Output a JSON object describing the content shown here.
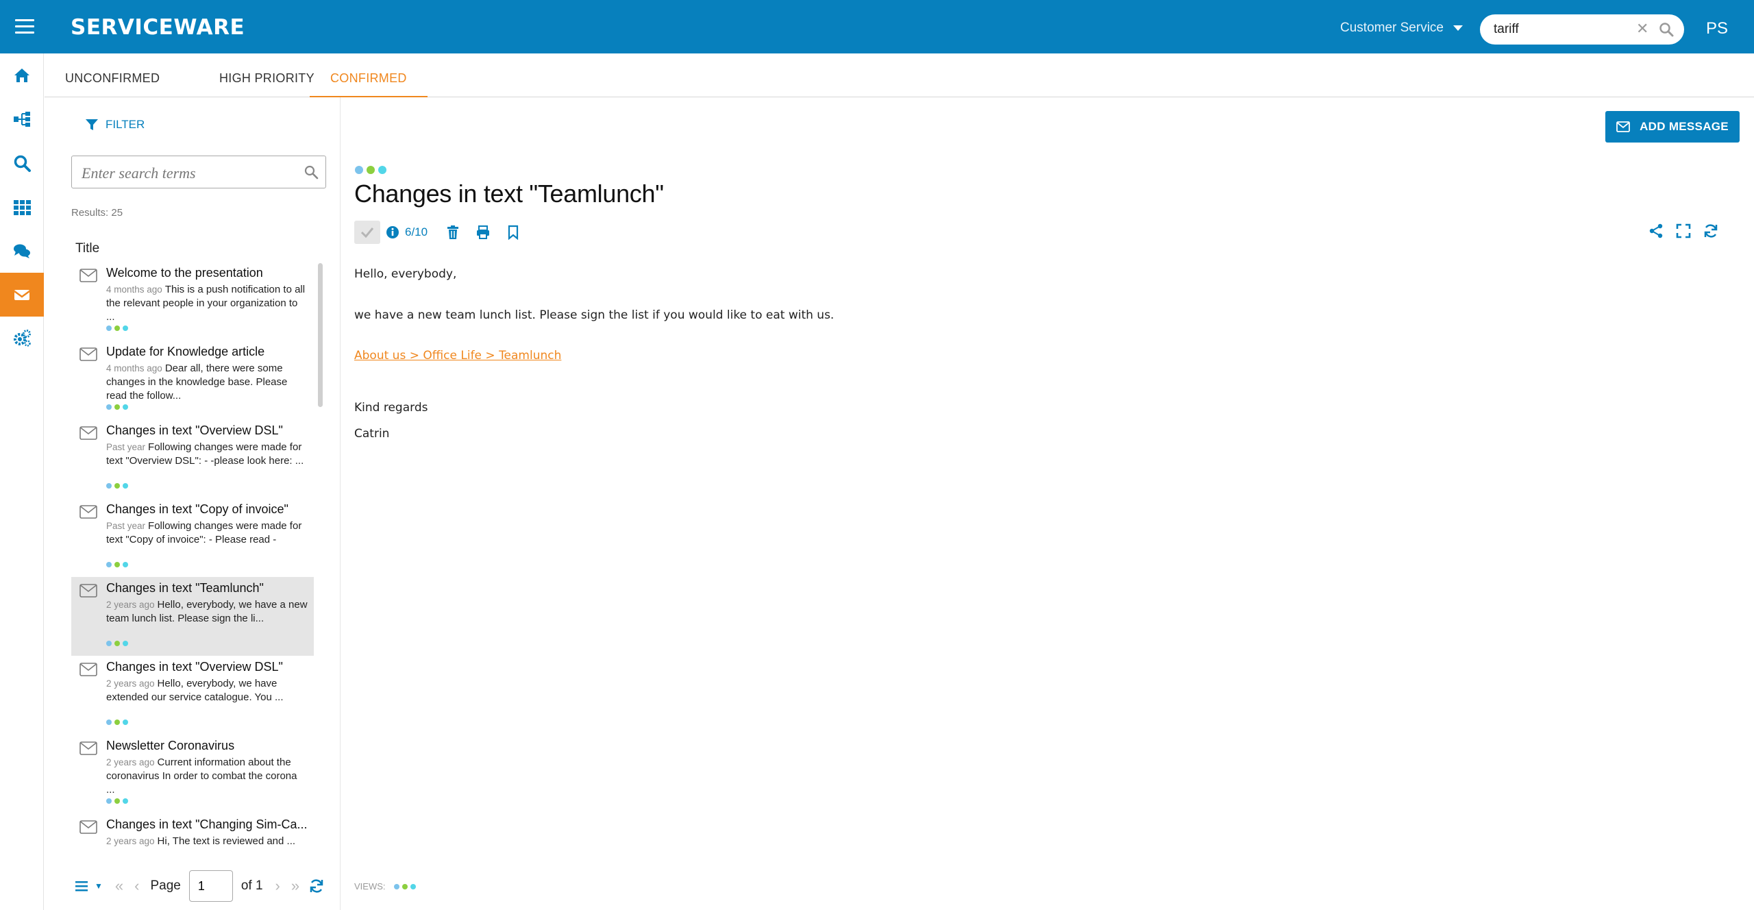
{
  "app": {
    "logo": "SERVICEWARE",
    "context": "Customer Service",
    "search_value": "tariff",
    "avatar": "PS"
  },
  "rail": {
    "items": [
      {
        "icon": "home-icon"
      },
      {
        "icon": "structure-icon"
      },
      {
        "icon": "search-icon"
      },
      {
        "icon": "grid-icon"
      },
      {
        "icon": "chat-icon"
      },
      {
        "icon": "envelope-icon",
        "active": true
      },
      {
        "icon": "settings-icon"
      }
    ]
  },
  "tabs": [
    {
      "label": "UNCONFIRMED"
    },
    {
      "label": "HIGH PRIORITY"
    },
    {
      "label": "CONFIRMED",
      "active": true
    }
  ],
  "list": {
    "filter_label": "FILTER",
    "search_placeholder": "Enter search terms",
    "results": "Results: 25",
    "column_title": "Title",
    "items": [
      {
        "title": "Welcome to the presentation",
        "date": "4 months ago",
        "snippet": "This is a push notification to all the relevant people in your organization to ..."
      },
      {
        "title": "Update for Knowledge article",
        "date": "4 months ago",
        "snippet": "Dear all, there were some changes in the knowledge base. Please read the follow..."
      },
      {
        "title": "Changes in text \"Overview DSL\"",
        "date": "Past year",
        "snippet": "Following changes were made for text \"Overview DSL\": - -please look here: ..."
      },
      {
        "title": "Changes in text \"Copy of invoice\"",
        "date": "Past year",
        "snippet": "Following changes were made for text \"Copy of invoice\": - Please read -"
      },
      {
        "title": "Changes in text \"Teamlunch\"",
        "date": "2 years ago",
        "snippet": "Hello, everybody, we have a new team lunch list. Please sign the li...",
        "selected": true
      },
      {
        "title": "Changes in text \"Overview DSL\"",
        "date": "2 years ago",
        "snippet": "Hello, everybody,  we have extended our service catalogue. You ..."
      },
      {
        "title": "Newsletter Coronavirus",
        "date": "2 years ago",
        "snippet": "Current information about the coronavirus   In order to combat the corona ..."
      },
      {
        "title": "Changes in text \"Changing Sim-Ca...",
        "date": "2 years ago",
        "snippet": "Hi,  The text is reviewed and ..."
      }
    ]
  },
  "pager": {
    "page_label": "Page",
    "page_value": "1",
    "of_label": "of 1"
  },
  "detail": {
    "add_message": "ADD MESSAGE",
    "title": "Changes in text \"Teamlunch\"",
    "ratio": "6/10",
    "body": {
      "greeting": "Hello, everybody,",
      "line1": "we have a new team lunch list. Please sign the list if you would like to eat with us.",
      "link": "About us > Office Life > Teamlunch",
      "regards": "Kind regards",
      "signature": "Catrin"
    },
    "views_label": "VIEWS:"
  },
  "colors": {
    "brand": "#0780bd",
    "accent": "#f0871e",
    "dot1": "#7cc3ec",
    "dot2": "#8ccf3f",
    "dot3": "#52d6e8"
  }
}
